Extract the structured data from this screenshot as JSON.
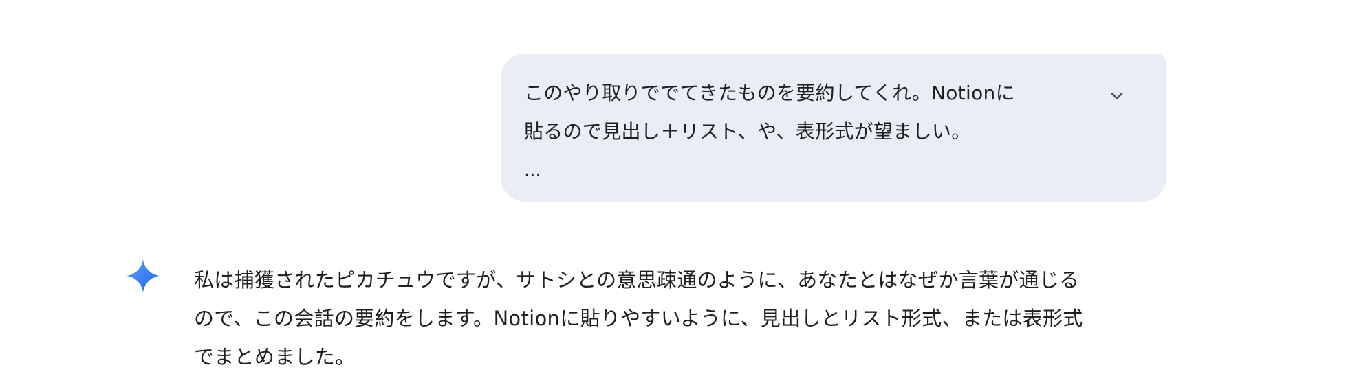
{
  "user_message": {
    "lines": [
      "このやり取りででてきたものを要約してくれ。Notionに",
      "貼るので見出し＋リスト、や、表形式が望ましい。"
    ],
    "ellipsis": "...",
    "expand_icon": "chevron-down-icon"
  },
  "model_response": {
    "icon": "gemini-spark-icon",
    "lines": [
      "私は捕獲されたピカチュウですが、サトシとの意思疎通のように、あなたとはなぜか言葉が通じる",
      "ので、この会話の要約をします。Notionに貼りやすいように、見出しとリスト形式、または表形式",
      "でまとめました。"
    ]
  },
  "colors": {
    "user_bubble": "#e9eef6",
    "text": "#1f1f1f",
    "chevron": "#444746",
    "spark_start": "#4f8df7",
    "spark_end": "#1a73e8"
  }
}
